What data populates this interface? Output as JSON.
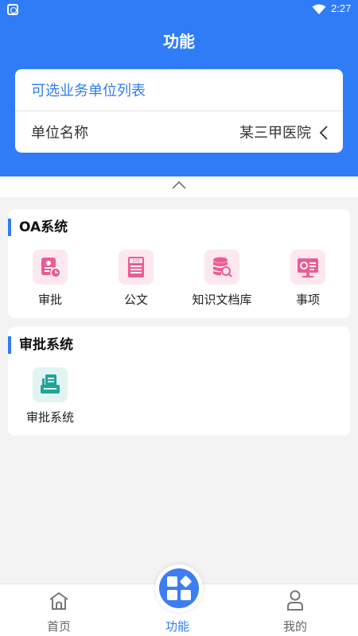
{
  "status_bar": {
    "time": "2:27"
  },
  "header": {
    "title": "功能"
  },
  "unit_card": {
    "list_title": "可选业务单位列表",
    "row_label": "单位名称",
    "row_value": "某三甲医院"
  },
  "sections": [
    {
      "title": "OA系统",
      "items": [
        {
          "label": "审批",
          "icon": "approval-icon"
        },
        {
          "label": "公文",
          "icon": "document-icon"
        },
        {
          "label": "知识文档库",
          "icon": "database-search-icon"
        },
        {
          "label": "事项",
          "icon": "monitor-task-icon"
        }
      ]
    },
    {
      "title": "审批系统",
      "items": [
        {
          "label": "审批系统",
          "icon": "printer-icon"
        }
      ]
    }
  ],
  "bottom_nav": {
    "home": "首页",
    "functions": "功能",
    "mine": "我的"
  },
  "colors": {
    "primary": "#2f7cf6",
    "pink": "#ec5c92",
    "teal": "#22a39a"
  }
}
